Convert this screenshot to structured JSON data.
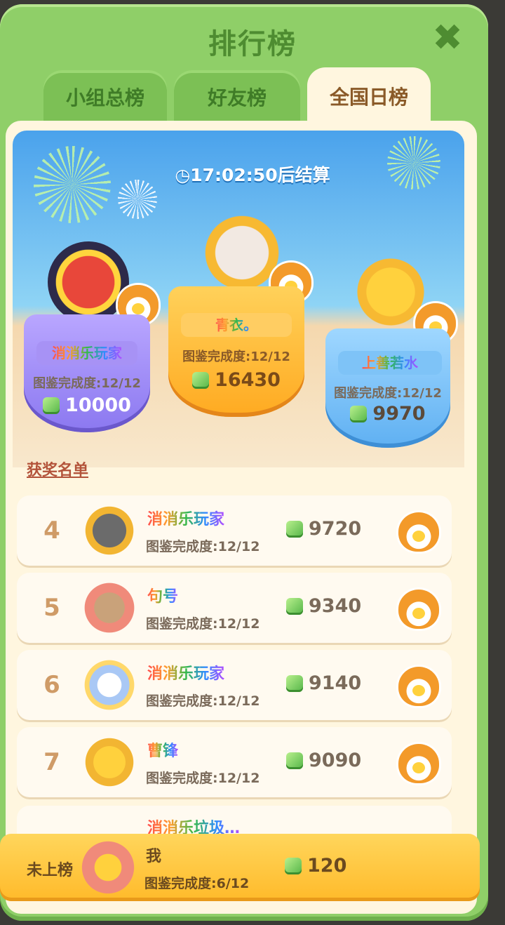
{
  "header": {
    "title": "排行榜",
    "close_icon": "close-icon"
  },
  "tabs": [
    {
      "label": "小组总榜",
      "active": false
    },
    {
      "label": "好友榜",
      "active": false
    },
    {
      "label": "全国日榜",
      "active": true
    }
  ],
  "timer": {
    "icon": "clock-icon",
    "text": "17:02:50后结算"
  },
  "podium": [
    {
      "place": 2,
      "name": "消消乐玩家",
      "progress": "图鉴完成度:12/12",
      "score": "10000"
    },
    {
      "place": 1,
      "name": "青衣。",
      "progress": "图鉴完成度:12/12",
      "score": "16430"
    },
    {
      "place": 3,
      "name": "上善若水",
      "progress": "图鉴完成度:12/12",
      "score": "9970"
    }
  ],
  "section_title": "获奖名单",
  "rows": [
    {
      "rank": "4",
      "name": "消消乐玩家",
      "progress": "图鉴完成度:12/12",
      "score": "9720"
    },
    {
      "rank": "5",
      "name": "句号",
      "progress": "图鉴完成度:12/12",
      "score": "9340"
    },
    {
      "rank": "6",
      "name": "消消乐玩家",
      "progress": "图鉴完成度:12/12",
      "score": "9140"
    },
    {
      "rank": "7",
      "name": "曹锋",
      "progress": "图鉴完成度:12/12",
      "score": "9090"
    },
    {
      "rank": "",
      "name": "消消乐垃圾…",
      "progress": "",
      "score": ""
    }
  ],
  "me": {
    "status": "未上榜",
    "name": "我",
    "progress": "图鉴完成度:6/12",
    "score": "120"
  }
}
